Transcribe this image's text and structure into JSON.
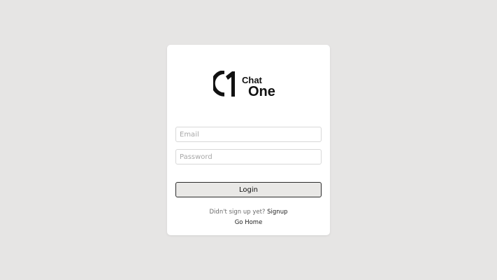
{
  "logo": {
    "line1": "Chat",
    "line2": "One"
  },
  "form": {
    "email_placeholder": "Email",
    "password_placeholder": "Password",
    "login_label": "Login"
  },
  "footer": {
    "signup_prompt": "Didn't sign up yet?",
    "signup_link": "Signup",
    "home_link": "Go Home"
  },
  "colors": {
    "background": "#e6e5e4",
    "card": "#ffffff",
    "button_bg": "#e9e8e6",
    "button_border": "#2b2b2b"
  }
}
